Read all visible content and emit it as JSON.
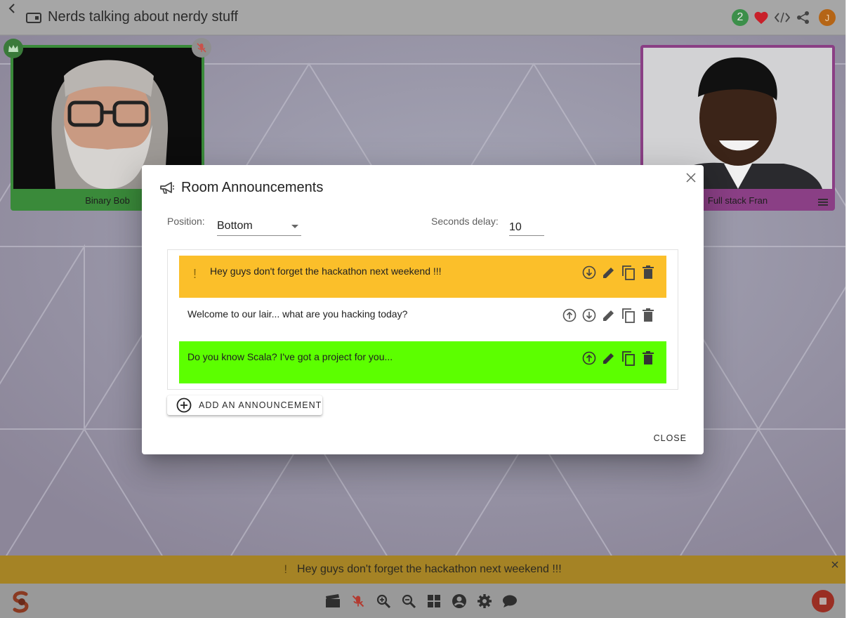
{
  "room": {
    "title": "Nerds talking about nerdy stuff",
    "participant_count": "2",
    "user_initial": "J"
  },
  "participants": [
    {
      "name": "Binary Bob",
      "frame_color": "#3a8a3a"
    },
    {
      "name": "Full stack Fran",
      "frame_color": "#8a3f85"
    }
  ],
  "dialog": {
    "title": "Room Announcements",
    "position_label": "Position:",
    "position_value": "Bottom",
    "delay_label": "Seconds delay:",
    "delay_value": "10",
    "announcements": [
      {
        "text": "Hey guys don't forget the hackathon next weekend !!!",
        "important": true,
        "mark": "!",
        "color": "#fbbf2a"
      },
      {
        "text": "Welcome to our lair... what are you hacking today?",
        "important": false,
        "mark": "",
        "color": "#ffffff"
      },
      {
        "text": "Do you know Scala? I've got a project for you...",
        "important": false,
        "mark": "",
        "color": "#5cff00"
      }
    ],
    "add_label": "ADD AN ANNOUNCEMENT",
    "close_label": "CLOSE"
  },
  "banner": {
    "mark": "!",
    "text": "Hey guys don't forget the hackathon next weekend !!!",
    "color": "#a58325"
  },
  "icons": {
    "top": [
      "heart-icon",
      "code-icon",
      "share-icon"
    ],
    "toolbar": [
      "clapperboard-icon",
      "mic-off-icon",
      "zoom-in-icon",
      "zoom-out-icon",
      "grid-icon",
      "account-icon",
      "settings-icon",
      "chat-icon"
    ],
    "row_actions": [
      "move-up-icon",
      "move-down-icon",
      "edit-icon",
      "copy-icon",
      "delete-icon"
    ]
  }
}
